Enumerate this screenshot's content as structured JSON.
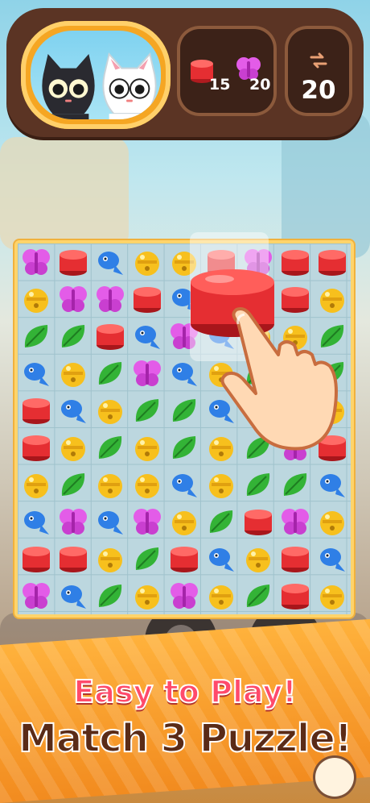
{
  "hud": {
    "goals": [
      {
        "icon": "red-block-icon",
        "count": "15"
      },
      {
        "icon": "pink-butterfly-icon",
        "count": "20"
      }
    ],
    "moves": {
      "icon": "swap-arrows-icon",
      "value": "20"
    }
  },
  "board": {
    "rows": [
      [
        "butterfly",
        "block",
        "fish",
        "bell",
        "bell",
        "block",
        "butterfly",
        "block",
        "block"
      ],
      [
        "bell",
        "butterfly",
        "butterfly",
        "block",
        "fish",
        "block",
        "block",
        "block",
        "bell"
      ],
      [
        "leaf",
        "leaf",
        "block",
        "fish",
        "butterfly",
        "fish",
        "bell",
        "bell",
        "leaf"
      ],
      [
        "fish",
        "bell",
        "leaf",
        "butterfly",
        "fish",
        "bell",
        "leaf",
        "leaf",
        "leaf"
      ],
      [
        "block",
        "fish",
        "bell",
        "leaf",
        "leaf",
        "fish",
        "bell",
        "bell",
        "bell"
      ],
      [
        "block",
        "bell",
        "leaf",
        "bell",
        "leaf",
        "bell",
        "leaf",
        "butterfly",
        "block"
      ],
      [
        "bell",
        "leaf",
        "bell",
        "bell",
        "fish",
        "bell",
        "leaf",
        "leaf",
        "fish"
      ],
      [
        "fish",
        "butterfly",
        "fish",
        "butterfly",
        "bell",
        "leaf",
        "block",
        "butterfly",
        "bell"
      ],
      [
        "block",
        "block",
        "bell",
        "leaf",
        "block",
        "fish",
        "bell",
        "block",
        "fish"
      ],
      [
        "butterfly",
        "fish",
        "leaf",
        "bell",
        "butterfly",
        "bell",
        "leaf",
        "block",
        "bell"
      ]
    ]
  },
  "colors": {
    "block": "#e52e32",
    "butterfly": "#e35ce8",
    "fish": "#2f7fe6",
    "bell": "#f7c01d",
    "leaf": "#33b336"
  },
  "banner": {
    "line1": "Easy to Play!",
    "line2": "Match 3 Puzzle!"
  }
}
